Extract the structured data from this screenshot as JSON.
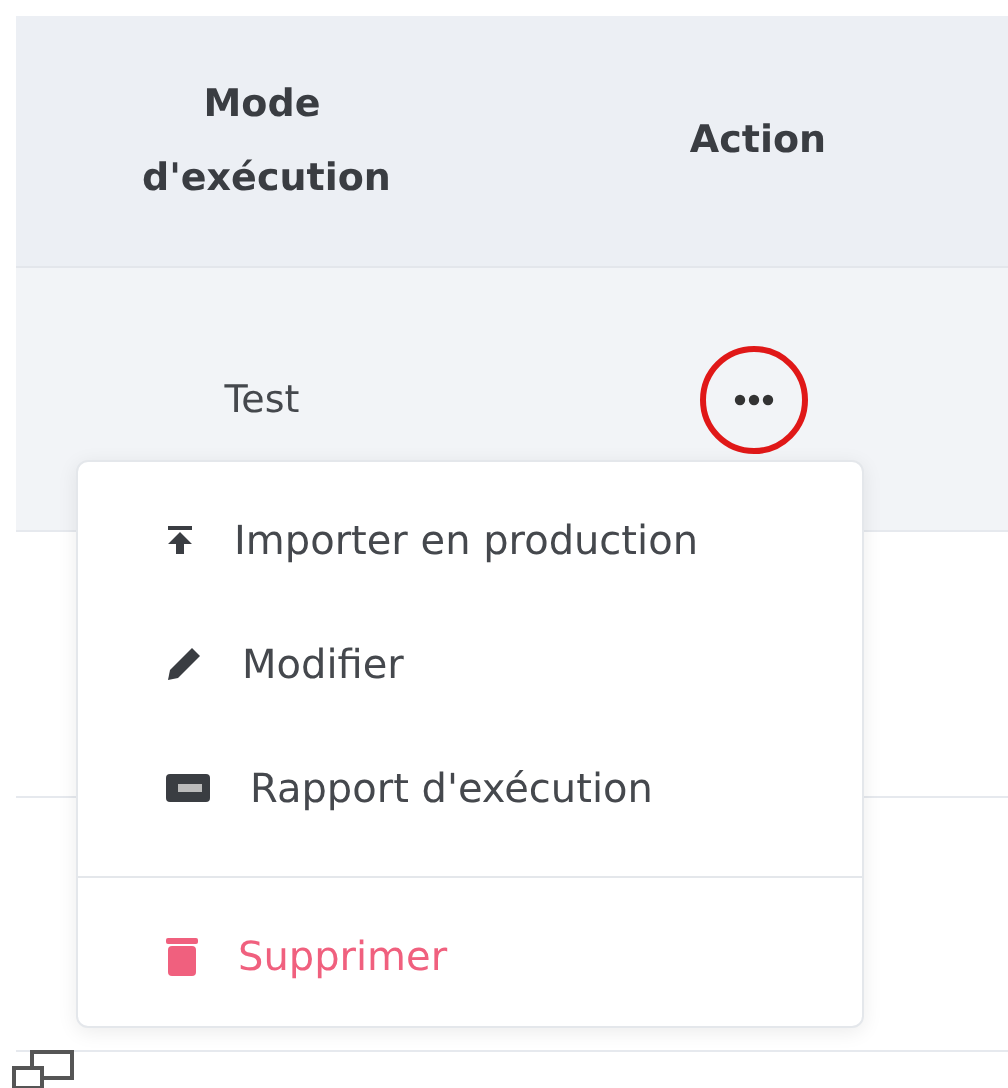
{
  "table": {
    "columns": [
      "Mode d'exécution",
      "Action"
    ],
    "rows": [
      {
        "mode": "Test",
        "action_menu_open": true
      }
    ]
  },
  "menu": {
    "items": [
      {
        "label": "Importer en production",
        "kind": "normal"
      },
      {
        "label": "Modifier",
        "kind": "normal"
      },
      {
        "label": "Rapport d'exécution",
        "kind": "normal"
      },
      {
        "label": "Supprimer",
        "kind": "danger"
      }
    ]
  }
}
